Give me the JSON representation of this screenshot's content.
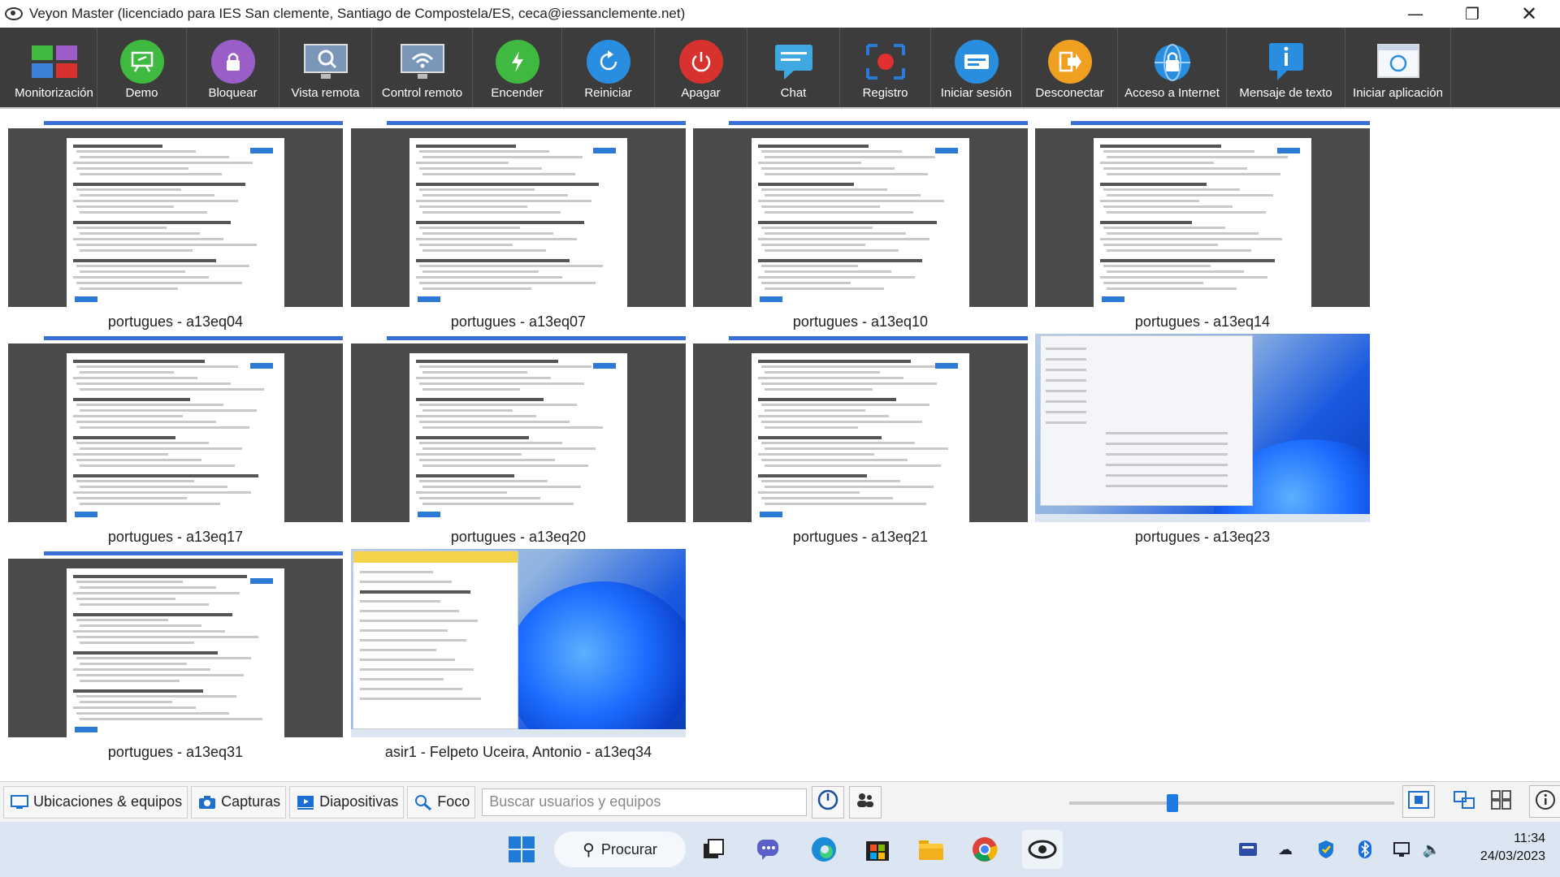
{
  "window": {
    "title": "Veyon Master (licenciado para IES San clemente, Santiago de Compostela/ES, ceca@iessanclemente.net)",
    "controls": [
      "minimize-icon",
      "maximize-icon",
      "close-icon"
    ]
  },
  "toolbar": {
    "buttons": [
      {
        "label": "Monitorización",
        "icon": "monitoring-icon",
        "color": "#3b82d8"
      },
      {
        "label": "Demo",
        "icon": "demo-icon",
        "color": "#3fb93f"
      },
      {
        "label": "Bloquear",
        "icon": "lock-icon",
        "color": "#9b5ec9"
      },
      {
        "label": "Vista remota",
        "icon": "remote-view-icon",
        "color": "#6a8caf"
      },
      {
        "label": "Control remoto",
        "icon": "remote-control-icon",
        "color": "#6a8caf"
      },
      {
        "label": "Encender",
        "icon": "power-on-icon",
        "color": "#3fb93f"
      },
      {
        "label": "Reiniciar",
        "icon": "reboot-icon",
        "color": "#2a8ee0"
      },
      {
        "label": "Apagar",
        "icon": "power-off-icon",
        "color": "#d8322f"
      },
      {
        "label": "Chat",
        "icon": "chat-icon",
        "color": "#3fa8e0"
      },
      {
        "label": "Registro",
        "icon": "screenshot-icon",
        "color": "#2a7ad8"
      },
      {
        "label": "Iniciar sesión",
        "icon": "login-icon",
        "color": "#2a8ee0"
      },
      {
        "label": "Desconectar",
        "icon": "logout-icon",
        "color": "#f0a020"
      },
      {
        "label": "Acceso a Internet",
        "icon": "internet-access-icon",
        "color": "#2a8ee0"
      },
      {
        "label": "Mensaje de texto",
        "icon": "text-message-icon",
        "color": "#2a8ee0"
      },
      {
        "label": "Iniciar aplicación",
        "icon": "start-app-icon",
        "color": "#2a8ee0"
      }
    ]
  },
  "computers": [
    {
      "caption": "portugues - a13eq04",
      "screen": "document"
    },
    {
      "caption": "portugues - a13eq07",
      "screen": "document"
    },
    {
      "caption": "portugues - a13eq10",
      "screen": "document"
    },
    {
      "caption": "portugues - a13eq14",
      "screen": "document"
    },
    {
      "caption": "portugues - a13eq17",
      "screen": "document"
    },
    {
      "caption": "portugues - a13eq20",
      "screen": "document"
    },
    {
      "caption": "portugues - a13eq21",
      "screen": "document"
    },
    {
      "caption": "portugues - a13eq23",
      "screen": "settings"
    },
    {
      "caption": "portugues - a13eq31",
      "screen": "document"
    },
    {
      "caption": "asir1 - Felpeto Uceira, Antonio - a13eq34",
      "screen": "desktop"
    }
  ],
  "bottom": {
    "locations_label": "Ubicaciones & equipos",
    "screenshots_label": "Capturas",
    "slideshow_label": "Diapositivas",
    "focus_label": "Foco",
    "search_placeholder": "Buscar usuarios y equipos",
    "zoom_level": 0.31
  },
  "taskbar": {
    "search_label": "Procurar",
    "time": "11:34",
    "date": "24/03/2023"
  },
  "colors": {
    "toolbar_bg": "#3c3c3c",
    "accent": "#1c7ae0",
    "taskbar_bg": "#dce6f3"
  }
}
